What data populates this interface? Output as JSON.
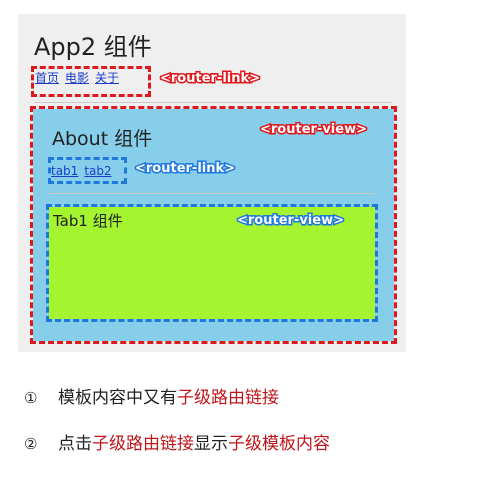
{
  "app": {
    "title": "App2 组件",
    "links": [
      "首页",
      "电影",
      "关于"
    ],
    "link_tag": "<router-link>",
    "view_tag": "<router-view>"
  },
  "about": {
    "title": "About 组件",
    "links": [
      "tab1",
      "tab2"
    ],
    "link_tag": "<router-link>",
    "view_tag": "<router-view>"
  },
  "tab1": {
    "title": "Tab1 组件"
  },
  "notes": [
    {
      "num": "①",
      "parts": [
        "模板内容中又有",
        "子级路由链接"
      ]
    },
    {
      "num": "②",
      "parts": [
        "点击",
        "子级路由链接",
        "显示",
        "子级模板内容"
      ]
    }
  ],
  "colors": {
    "red_dash": "#e0181d",
    "blue_dash": "#1e78de",
    "about_bg": "#87ceeb",
    "tab_bg": "#a4f52f",
    "highlight": "#c0141a"
  }
}
